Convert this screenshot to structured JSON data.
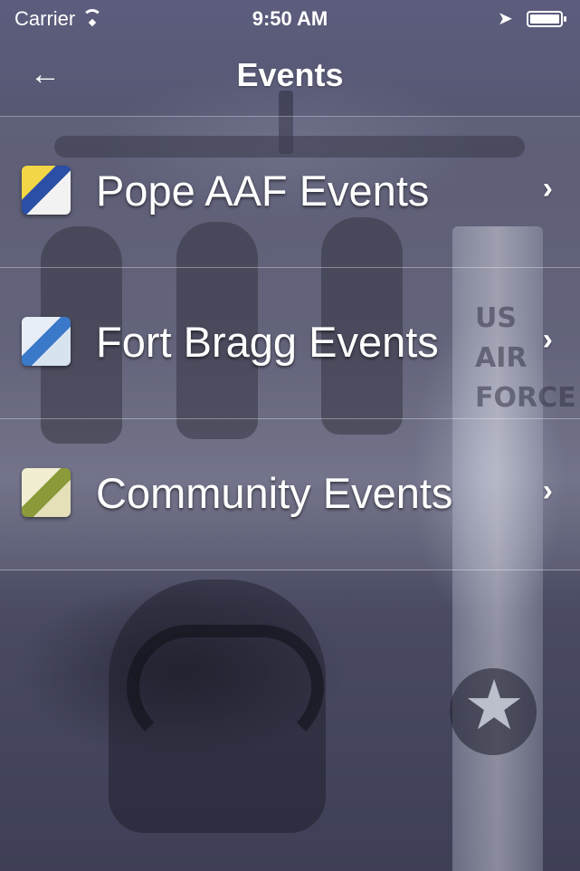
{
  "status_bar": {
    "carrier": "Carrier",
    "time": "9:50 AM",
    "wifi_icon": "wifi-icon",
    "location_icon": "location-arrow-icon",
    "battery_icon": "battery-icon",
    "battery_level": 1.0
  },
  "nav": {
    "back_icon": "back-arrow-icon",
    "back_glyph": "←",
    "title": "Events"
  },
  "list": {
    "items": [
      {
        "label": "Pope AAF Events",
        "icon": "pope-aaf-cube-icon",
        "chevron": "›"
      },
      {
        "label": "Fort Bragg Events",
        "icon": "fort-bragg-cube-icon",
        "chevron": "›"
      },
      {
        "label": "Community Events",
        "icon": "community-cube-icon",
        "chevron": "›"
      }
    ]
  },
  "background": {
    "pylon_text": "US AIR FORCE",
    "star_glyph": "★"
  },
  "colors": {
    "background_top": "#5c5d7d",
    "background_bottom": "#3e3f56",
    "text": "#ffffff"
  }
}
